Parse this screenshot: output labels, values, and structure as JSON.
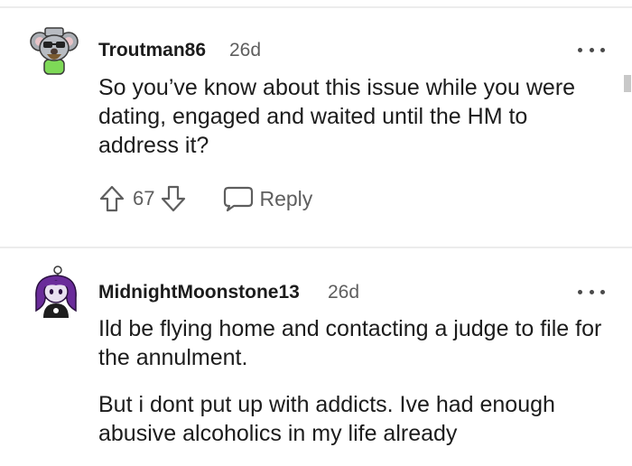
{
  "comments": [
    {
      "username": "Troutman86",
      "age": "26d",
      "avatar_icon": "koala-avatar-icon",
      "paragraphs": [
        "So you’ve know about this issue while you were dating, engaged and waited until the HM to address it?"
      ],
      "score": "67",
      "reply_label": "Reply"
    },
    {
      "username": "MidnightMoonstone13",
      "age": "26d",
      "avatar_icon": "purple-hair-avatar-icon",
      "paragraphs": [
        "Ild be flying home and contacting a judge to file for the annulment.",
        "But i dont put up with addicts. Ive had enough abusive alcoholics in my life already"
      ]
    }
  ],
  "colors": {
    "text": "#1c1c1c",
    "meta": "#5e5e5e",
    "divider": "#ececec"
  }
}
